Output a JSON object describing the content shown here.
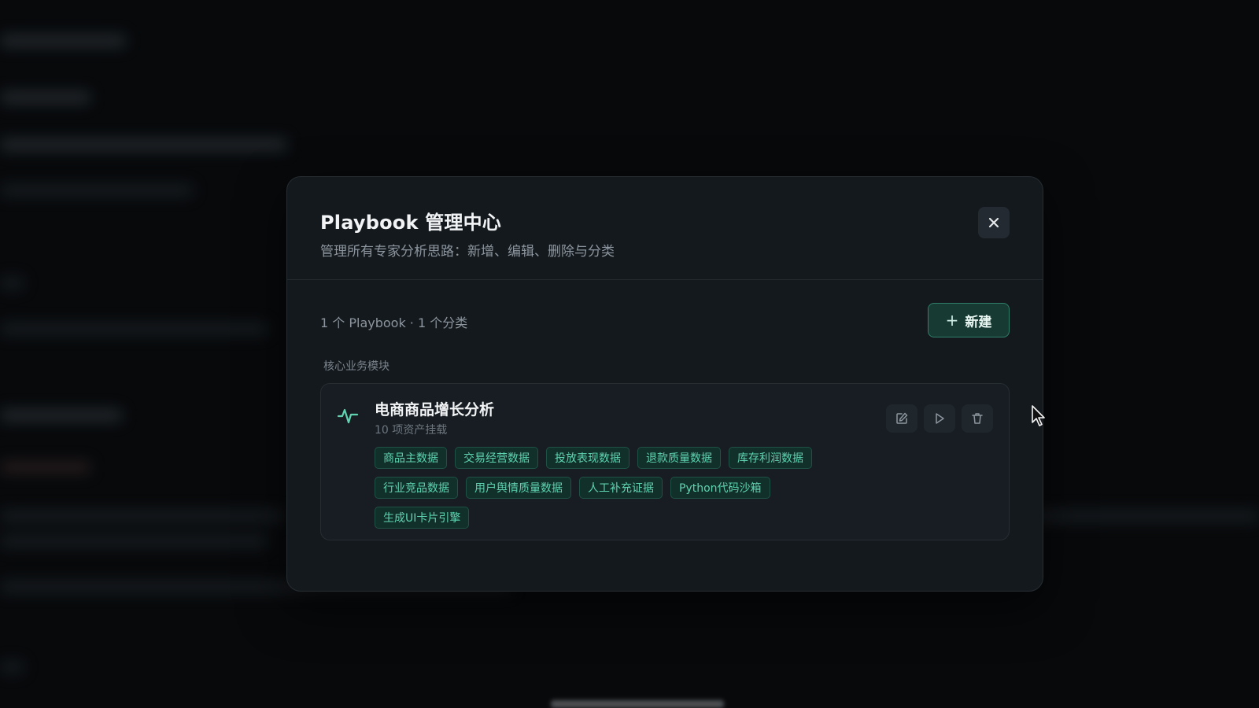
{
  "modal": {
    "title": "Playbook 管理中心",
    "subtitle": "管理所有专家分析思路：新增、编辑、删除与分类",
    "close_icon": "close-icon"
  },
  "toolbar": {
    "counts": "1 个 Playbook · 1 个分类",
    "new_button_icon": "plus-icon",
    "new_button_label": "新建"
  },
  "category": {
    "label": "核心业务模块"
  },
  "playbooks": [
    {
      "icon": "activity-pulse-icon",
      "title": "电商商品增长分析",
      "subtitle": "10 项资产挂载",
      "actions": [
        "edit-icon",
        "play-icon",
        "trash-icon"
      ],
      "tags": [
        "商品主数据",
        "交易经营数据",
        "投放表现数据",
        "退款质量数据",
        "库存利润数据",
        "行业竞品数据",
        "用户舆情质量数据",
        "人工补充证据",
        "Python代码沙箱",
        "生成UI卡片引擎"
      ]
    }
  ],
  "colors": {
    "accent": "#5fd3b1",
    "background": "#07090b",
    "modal_background": "#14191e"
  }
}
